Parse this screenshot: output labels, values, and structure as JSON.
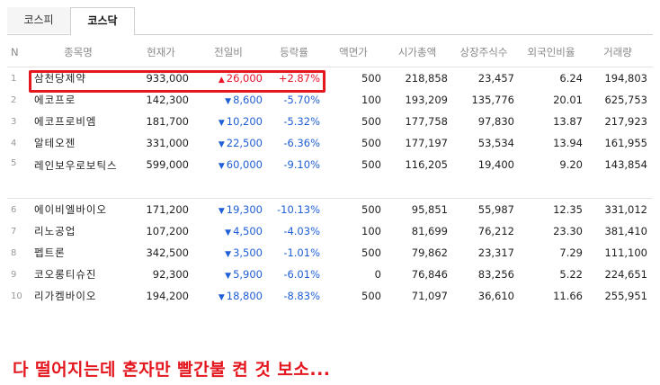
{
  "tabs": [
    {
      "label": "코스피",
      "active": false
    },
    {
      "label": "코스닥",
      "active": true
    }
  ],
  "table": {
    "headers": [
      "N",
      "종목명",
      "현재가",
      "전일비",
      "등락률",
      "액면가",
      "시가총액",
      "상장주식수",
      "외국인비율",
      "거래량"
    ],
    "rows": [
      {
        "n": "1",
        "name": "삼천당제약",
        "price": "933,000",
        "change": "26,000",
        "dir": "up",
        "rate": "+2.87%",
        "face": "500",
        "cap": "218,858",
        "shares": "23,457",
        "foreign": "6.24",
        "volume": "194,803"
      },
      {
        "n": "2",
        "name": "에코프로",
        "price": "142,300",
        "change": "8,600",
        "dir": "down",
        "rate": "-5.70%",
        "face": "100",
        "cap": "193,209",
        "shares": "135,776",
        "foreign": "20.01",
        "volume": "625,753"
      },
      {
        "n": "3",
        "name": "에코프로비엠",
        "price": "181,700",
        "change": "10,200",
        "dir": "down",
        "rate": "-5.32%",
        "face": "500",
        "cap": "177,758",
        "shares": "97,830",
        "foreign": "13.87",
        "volume": "217,923"
      },
      {
        "n": "4",
        "name": "알테오젠",
        "price": "331,000",
        "change": "22,500",
        "dir": "down",
        "rate": "-6.36%",
        "face": "500",
        "cap": "177,197",
        "shares": "53,534",
        "foreign": "13.94",
        "volume": "161,955"
      },
      {
        "n": "5",
        "name": "레인보우로보틱스",
        "price": "599,000",
        "change": "60,000",
        "dir": "down",
        "rate": "-9.10%",
        "face": "500",
        "cap": "116,205",
        "shares": "19,400",
        "foreign": "9.20",
        "volume": "143,854"
      },
      {
        "n": "6",
        "name": "에이비엘바이오",
        "price": "171,200",
        "change": "19,300",
        "dir": "down",
        "rate": "-10.13%",
        "face": "500",
        "cap": "95,851",
        "shares": "55,987",
        "foreign": "12.35",
        "volume": "331,012"
      },
      {
        "n": "7",
        "name": "리노공업",
        "price": "107,200",
        "change": "4,500",
        "dir": "down",
        "rate": "-4.03%",
        "face": "100",
        "cap": "81,699",
        "shares": "76,212",
        "foreign": "23.30",
        "volume": "381,410"
      },
      {
        "n": "8",
        "name": "펩트론",
        "price": "342,500",
        "change": "3,500",
        "dir": "down",
        "rate": "-1.01%",
        "face": "500",
        "cap": "79,862",
        "shares": "23,317",
        "foreign": "7.29",
        "volume": "111,100"
      },
      {
        "n": "9",
        "name": "코오롱티슈진",
        "price": "92,300",
        "change": "5,900",
        "dir": "down",
        "rate": "-6.01%",
        "face": "0",
        "cap": "76,846",
        "shares": "83,256",
        "foreign": "5.22",
        "volume": "224,651"
      },
      {
        "n": "10",
        "name": "리가켐바이오",
        "price": "194,200",
        "change": "18,800",
        "dir": "down",
        "rate": "-8.83%",
        "face": "500",
        "cap": "71,097",
        "shares": "36,610",
        "foreign": "11.66",
        "volume": "255,951"
      }
    ]
  },
  "arrows": {
    "up": "▲",
    "down": "▼"
  },
  "colors": {
    "up": "#e8142a",
    "down": "#1f5fd6",
    "highlight": "#e4161e"
  },
  "caption": "다 떨어지는데 혼자만 빨간불 켠 것 보소..."
}
